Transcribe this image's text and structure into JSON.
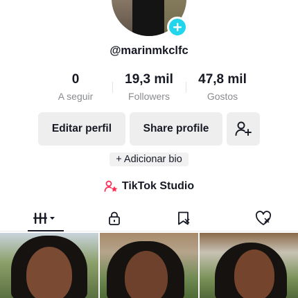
{
  "profile": {
    "username": "@marinmkclfc"
  },
  "stats": [
    {
      "value": "0",
      "label": "A seguir"
    },
    {
      "value": "19,3 mil",
      "label": "Followers"
    },
    {
      "value": "47,8 mil",
      "label": "Gostos"
    }
  ],
  "buttons": {
    "edit_label": "Editar perfil",
    "share_label": "Share profile"
  },
  "bio": {
    "add_label": "+ Adicionar bio"
  },
  "studio": {
    "label": "TikTok Studio"
  },
  "tabs": [
    {
      "icon": "videos-grid-icon"
    },
    {
      "icon": "lock-icon"
    },
    {
      "icon": "favorites-icon"
    },
    {
      "icon": "liked-icon"
    }
  ],
  "colors": {
    "accent": "#20d5ec",
    "studio_icon": "#fe2c55",
    "button_bg": "#eeeeef",
    "muted_text": "#8a8b91"
  }
}
